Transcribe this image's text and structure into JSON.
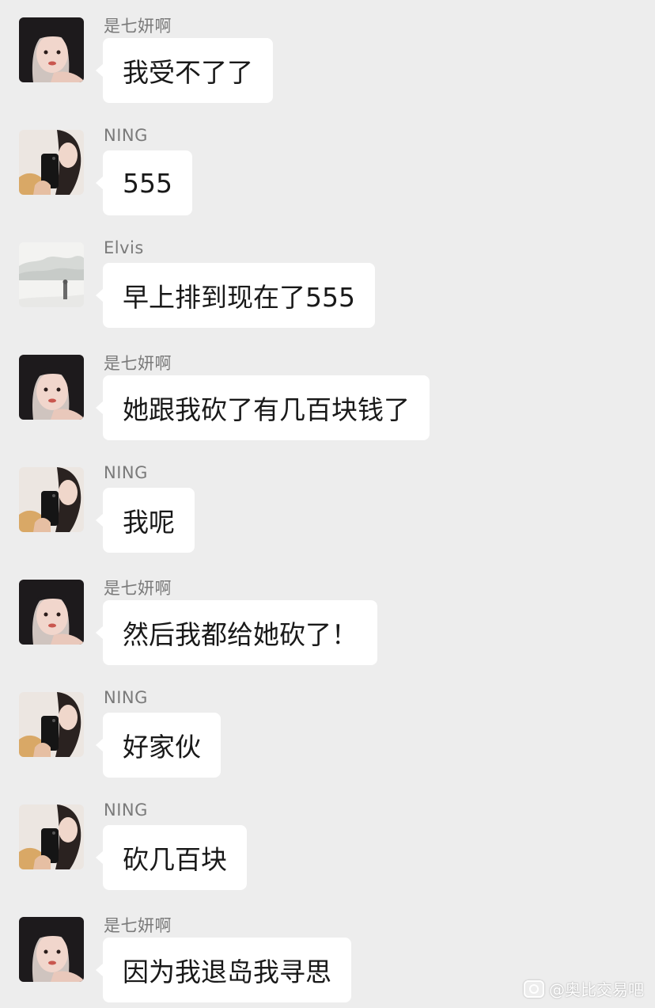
{
  "messages": [
    {
      "sender": "是七妍啊",
      "text": "我受不了了",
      "avatar": "girl-portrait-avatar"
    },
    {
      "sender": "NING",
      "text": "555",
      "avatar": "mirror-selfie-avatar"
    },
    {
      "sender": "Elvis",
      "text": "早上排到现在了555",
      "avatar": "ink-landscape-avatar"
    },
    {
      "sender": "是七妍啊",
      "text": "她跟我砍了有几百块钱了",
      "avatar": "girl-portrait-avatar"
    },
    {
      "sender": "NING",
      "text": "我呢",
      "avatar": "mirror-selfie-avatar"
    },
    {
      "sender": "是七妍啊",
      "text": "然后我都给她砍了！",
      "avatar": "girl-portrait-avatar"
    },
    {
      "sender": "NING",
      "text": "好家伙",
      "avatar": "mirror-selfie-avatar"
    },
    {
      "sender": "NING",
      "text": "砍几百块",
      "avatar": "mirror-selfie-avatar"
    },
    {
      "sender": "是七妍啊",
      "text": "因为我退岛我寻思",
      "avatar": "girl-portrait-avatar"
    }
  ],
  "watermark": {
    "text": "@奥比交易吧",
    "icon": "weibo-logo-icon"
  },
  "colors": {
    "background": "#ededed",
    "bubble": "#ffffff",
    "sender": "#7a7a7a",
    "text": "#191919"
  }
}
